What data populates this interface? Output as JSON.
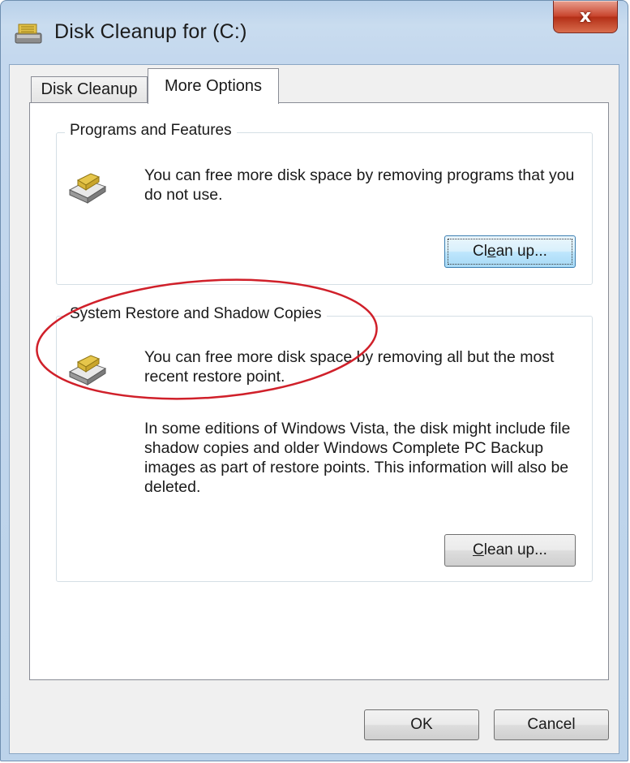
{
  "window": {
    "title": "Disk Cleanup for  (C:)",
    "close_glyph": "x"
  },
  "tabs": [
    {
      "label": "Disk Cleanup",
      "active": false
    },
    {
      "label": "More Options",
      "active": true
    }
  ],
  "programs_group": {
    "title": "Programs and Features",
    "icon": "drive-icon",
    "description": "You can free more disk space by removing programs that you do not use.",
    "button": {
      "before": "Cl",
      "mnemonic": "e",
      "after": "an up..."
    }
  },
  "restore_group": {
    "title": "System Restore and Shadow Copies",
    "icon": "drive-icon",
    "description": "You can free more disk space by removing all but the most recent restore point.",
    "extra": "In some editions of Windows Vista, the disk might include file shadow copies and older Windows Complete PC Backup images as part of restore points. This information will also be deleted.",
    "button": {
      "before": "",
      "mnemonic": "C",
      "after": "lean up..."
    }
  },
  "footer": {
    "ok_label": "OK",
    "cancel_label": "Cancel"
  },
  "colors": {
    "annotation": "#d0202a",
    "close_button": "#c9462f",
    "focus_button": "#3c7fb1"
  }
}
